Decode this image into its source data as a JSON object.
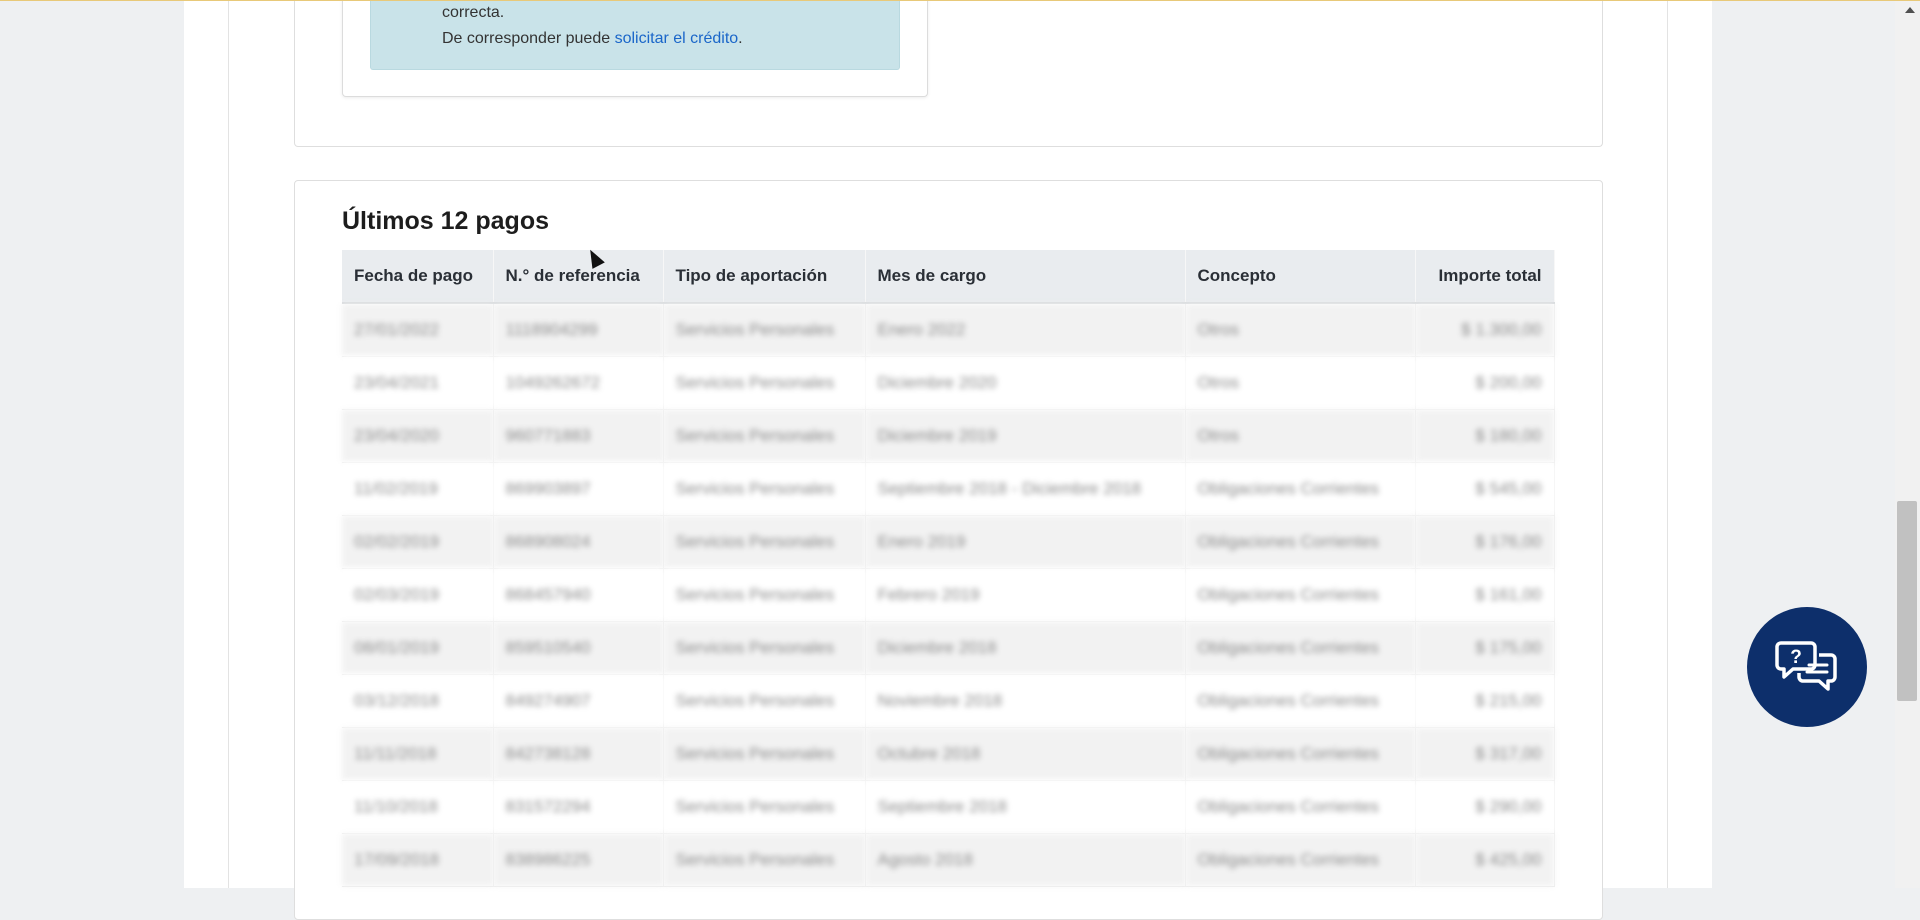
{
  "alert": {
    "line1": "correcta.",
    "line2_prefix": "De corresponder puede ",
    "line2_link": "solicitar el crédito",
    "line2_suffix": "."
  },
  "payments": {
    "title": "Últimos 12 pagos",
    "columns": [
      "Fecha de pago",
      "N.° de referencia",
      "Tipo de aportación",
      "Mes de cargo",
      "Concepto",
      "Importe total"
    ],
    "rows": [
      [
        "27/01/2022",
        "1118904299",
        "Servicios Personales",
        "Enero 2022",
        "Otros",
        "$ 1.300,00"
      ],
      [
        "23/04/2021",
        "1049262672",
        "Servicios Personales",
        "Diciembre 2020",
        "Otros",
        "$ 200,00"
      ],
      [
        "23/04/2020",
        "960771883",
        "Servicios Personales",
        "Diciembre 2019",
        "Otros",
        "$ 180,00"
      ],
      [
        "11/02/2019",
        "869903897",
        "Servicios Personales",
        "Septiembre 2018 - Diciembre 2018",
        "Obligaciones Corrientes",
        "$ 545,00"
      ],
      [
        "02/02/2019",
        "868908024",
        "Servicios Personales",
        "Enero 2019",
        "Obligaciones Corrientes",
        "$ 176,00"
      ],
      [
        "02/03/2019",
        "868457940",
        "Servicios Personales",
        "Febrero 2019",
        "Obligaciones Corrientes",
        "$ 161,00"
      ],
      [
        "08/01/2019",
        "859510540",
        "Servicios Personales",
        "Diciembre 2018",
        "Obligaciones Corrientes",
        "$ 175,00"
      ],
      [
        "03/12/2018",
        "849274907",
        "Servicios Personales",
        "Noviembre 2018",
        "Obligaciones Corrientes",
        "$ 215,00"
      ],
      [
        "11/11/2018",
        "842738128",
        "Servicios Personales",
        "Octubre 2018",
        "Obligaciones Corrientes",
        "$ 317,00"
      ],
      [
        "11/10/2018",
        "831572294",
        "Servicios Personales",
        "Septiembre 2018",
        "Obligaciones Corrientes",
        "$ 290,00"
      ],
      [
        "17/09/2018",
        "838986225",
        "Servicios Personales",
        "Agosto 2018",
        "Obligaciones Corrientes",
        "$ 425,00"
      ]
    ]
  },
  "chat": {
    "icon": "chat-help-icon"
  },
  "colors": {
    "accent": "#0d2f6b",
    "link": "#1a66c9",
    "alert_bg": "#c9e3e9"
  }
}
